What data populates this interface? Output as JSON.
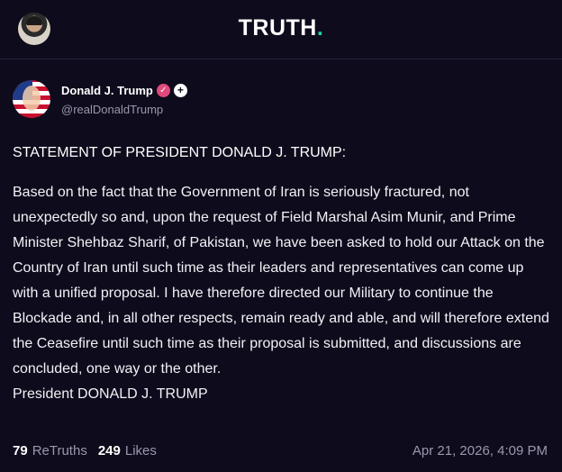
{
  "header": {
    "logo_main": "TRUTH",
    "logo_dot": "."
  },
  "post": {
    "display_name": "Donald J. Trump",
    "handle": "@realDonaldTrump",
    "verified_icon": "verified-badge-icon",
    "heading": "STATEMENT OF PRESIDENT DONALD J. TRUMP:",
    "body": "Based on the fact that the Government of Iran is seriously fractured, not unexpectedly so and, upon the request of Field Marshal Asim Munir, and Prime Minister Shehbaz Sharif, of Pakistan, we have been asked to hold our Attack on the Country of Iran until such time as their leaders and representatives can come up with a unified proposal. I have therefore directed our Military to continue the Blockade and, in all other respects, remain ready and able, and will therefore extend the Ceasefire until such time as their proposal is submitted, and discussions are concluded, one way or the other.",
    "signature": "President DONALD J. TRUMP",
    "retruths_count": "79",
    "retruths_label": "ReTruths",
    "likes_count": "249",
    "likes_label": "Likes",
    "timestamp": "Apr 21, 2026, 4:09 PM"
  },
  "colors": {
    "background": "#0e0b1c",
    "accent": "#17d7a0",
    "verified": "#e04a7a",
    "muted": "#9b97ad"
  }
}
